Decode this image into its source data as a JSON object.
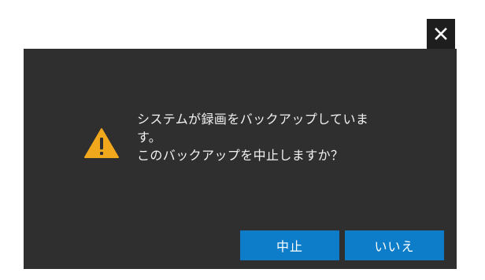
{
  "dialog": {
    "close_icon": "close-icon",
    "warning_icon": "warning-icon",
    "message_lines": [
      "システムが録画をバックアップしていま",
      "す。",
      "このバックアップを中止しますか？"
    ],
    "buttons": {
      "stop_label": "中止",
      "no_label": "いいえ"
    }
  },
  "colors": {
    "dialog_bg": "#2f2f2f",
    "close_bg": "#1e1e1e",
    "button_bg": "#0d7cc9",
    "warning": "#f2a81d"
  }
}
